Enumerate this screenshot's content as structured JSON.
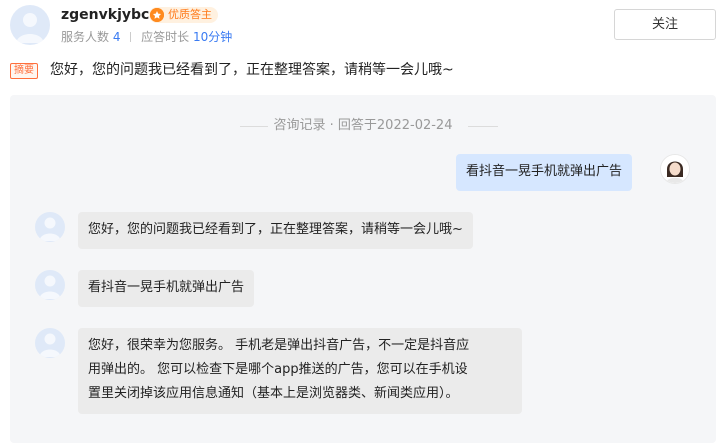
{
  "header": {
    "username": "zgenvkjybcd",
    "badge_label": "优质答主",
    "meta_service_label": "服务人数",
    "meta_service_count": "4",
    "meta_response_label": "应答时长",
    "meta_response_value": "10分钟",
    "follow_label": "关注"
  },
  "summary": {
    "tag": "摘要",
    "text": "您好，您的问题我已经看到了，正在整理答案，请稍等一会儿哦~"
  },
  "chat": {
    "record_title": "咨询记录 · 回答于2022-02-24",
    "messages": [
      {
        "from": "user",
        "text": "看抖音一晃手机就弹出广告"
      },
      {
        "from": "expert",
        "text": "您好，您的问题我已经看到了，正在整理答案，请稍等一会儿哦~"
      },
      {
        "from": "expert",
        "text": "看抖音一晃手机就弹出广告"
      },
      {
        "from": "expert",
        "lines": [
          "您好，很荣幸为您服务。 手机老是弹出抖音广告，不一定是抖音应",
          "用弹出的。 您可以检查下是哪个app推送的广告，您可以在手机设",
          "置里关闭掉该应用信息通知（基本上是浏览器类、新闻类应用）。"
        ]
      }
    ]
  },
  "colors": {
    "accent_blue": "#3a7bf2",
    "badge_orange": "#ff7a1a",
    "summary_tag": "#ff6f3c",
    "user_bubble": "#d6e7ff",
    "expert_bubble": "#ebebeb",
    "panel_bg": "#f5f6f8"
  }
}
